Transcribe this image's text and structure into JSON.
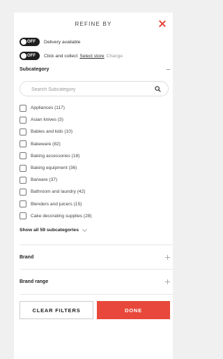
{
  "header": {
    "title": "REFINE BY"
  },
  "delivery": {
    "toggle_label": "OFF",
    "text": "Delivery available"
  },
  "click_collect": {
    "toggle_label": "OFF",
    "text": "Click and collect",
    "link": "Select store",
    "change": "Change"
  },
  "subcategory": {
    "title": "Subcategory",
    "search_placeholder": "Search Subcategory",
    "items": [
      {
        "label": "Appliances (117)"
      },
      {
        "label": "Asian knives (3)"
      },
      {
        "label": "Babies and kids (10)"
      },
      {
        "label": "Bakeware (82)"
      },
      {
        "label": "Baking accessories (18)"
      },
      {
        "label": "Baking equipment (36)"
      },
      {
        "label": "Barware (37)"
      },
      {
        "label": "Bathroom and laundry (42)"
      },
      {
        "label": "Blenders and juicers (15)"
      },
      {
        "label": "Cake decorating supplies (28)"
      }
    ],
    "show_all": "Show all 59 subcategories"
  },
  "filters": {
    "brand": "Brand",
    "brand_range": "Brand range"
  },
  "buttons": {
    "clear": "CLEAR FILTERS",
    "done": "DONE"
  },
  "colors": {
    "accent": "#e8483b",
    "toggle": "#1f1f1f"
  }
}
